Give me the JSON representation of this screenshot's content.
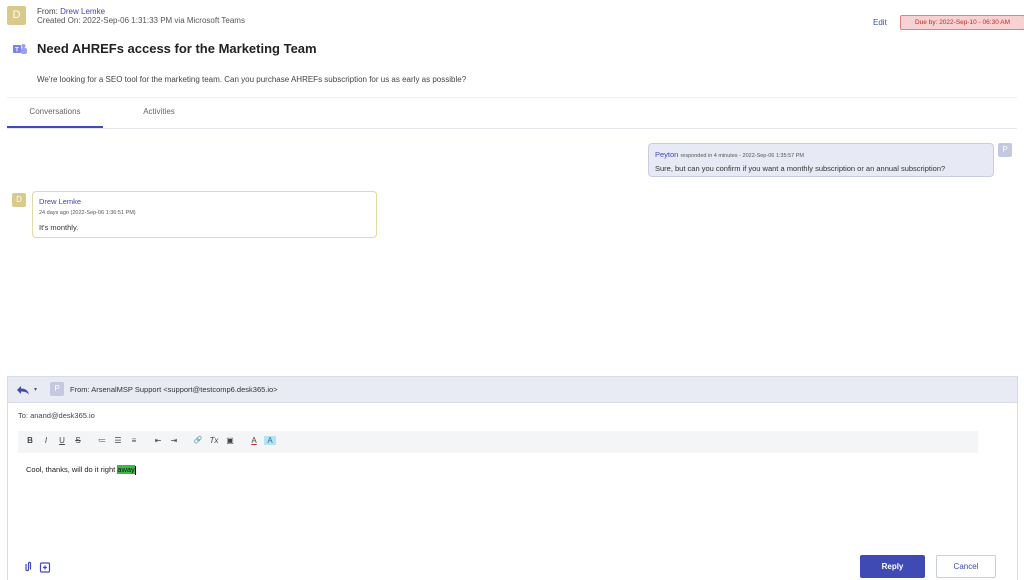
{
  "ticket": {
    "avatar_letter": "D",
    "from_label": "From: ",
    "from_name": "Drew Lemke",
    "created": "Created On: 2022-Sep-06 1:31:33 PM via Microsoft Teams",
    "title": "Need AHREFs access for the Marketing Team",
    "description": "We're looking for a SEO tool for the marketing team. Can you purchase AHREFs subscription for us as early as possible?",
    "edit_label": "Edit",
    "due_badge": "Due by: 2022-Sep-10 - 06:30 AM"
  },
  "tabs": [
    {
      "label": "Conversations",
      "active": true
    },
    {
      "label": "Activities",
      "active": false
    }
  ],
  "messages": {
    "agent": {
      "avatar": "P",
      "name": "Peyton",
      "meta": "responded in 4 minutes - 2022-Sep-06 1:35:57 PM",
      "text": "Sure, but can you confirm if you want a monthly subscription or an annual subscription?"
    },
    "customer": {
      "avatar": "D",
      "name": "Drew Lemke",
      "meta": "24 days ago (2022-Sep-06 1:36:51 PM)",
      "text": "It's monthly."
    }
  },
  "reply": {
    "avatar": "P",
    "from": "From: ArsenalMSP Support <support@testcomp6.desk365.io>",
    "to": "To: anand@desk365.io",
    "toolbar": [
      "B",
      "I",
      "U",
      "S",
      "≔",
      "☰",
      "≡",
      "⇤",
      "⇥",
      "🔗",
      "Tx",
      "▣",
      "A",
      "A"
    ],
    "body_text": "Cool, thanks, will do it right ",
    "body_highlight": "away",
    "reply_label": "Reply",
    "cancel_label": "Cancel"
  },
  "colors": {
    "accent": "#3f4ab5",
    "due_bg": "#f7d2d2",
    "highlight": "#3db94c"
  }
}
